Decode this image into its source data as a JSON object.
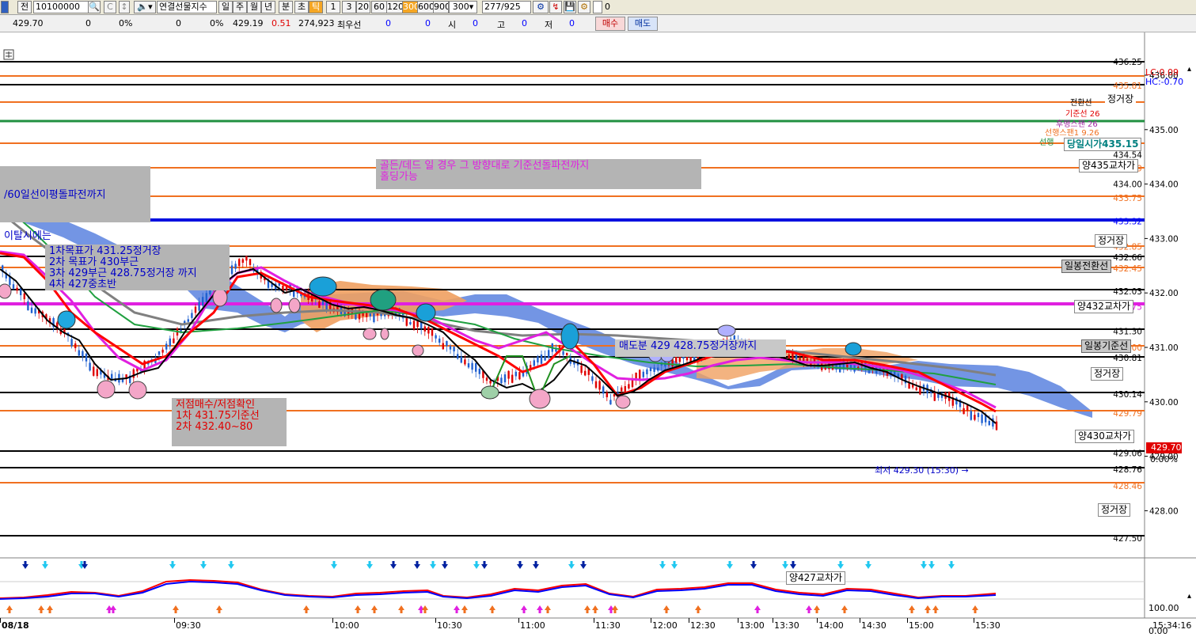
{
  "toolbar": {
    "jeon": "전",
    "code": "10100000",
    "product": "연결선물지수",
    "period_buttons": [
      "일",
      "주",
      "월",
      "년",
      "분",
      "초",
      "틱"
    ],
    "active_period": "틱",
    "intervals": [
      "1",
      "3",
      "20",
      "60",
      "120",
      "300",
      "600",
      "900"
    ],
    "active_interval": "300",
    "interval_select": "300",
    "page_counter": "277/925",
    "check_value": "0"
  },
  "quote": {
    "price": "429.70",
    "v1": "0",
    "pct1": "0%",
    "v2": "0",
    "pct2": "0%",
    "last": "429.19",
    "change": "0.51",
    "volume": "274,923",
    "best_label": "최우선",
    "best_bid": "0",
    "best_ask": "0",
    "open_label": "시",
    "open_val": "0",
    "high_label": "고",
    "high_val": "0",
    "low_label": "저",
    "low_val": "0",
    "buy_label": "매수",
    "sell_label": "매도"
  },
  "chart": {
    "lc": "LC:0.09",
    "hc": "HC:-0.70",
    "last_price_tag": "429.70",
    "last_pct": "0.00%",
    "low_note": "최저 429.30 (15:30)",
    "top_right_labels": [
      "전환선",
      "기준선 26",
      "후행스팬 26",
      "선행스팬1 9.26",
      "선행"
    ],
    "line_values": {
      "v436_25": "436.25",
      "v435_81": "435.81",
      "v434_54": "434.54",
      "v434_29": "434.29",
      "v434_00": "434.00",
      "v433_75": "433.75",
      "v433_32": "433.32",
      "v432_85": "432.85",
      "v432_66": "432.66",
      "v432_45": "432.45",
      "v432_03": "432.03",
      "v431_75": "431.75",
      "v431_30": "431.30",
      "v431_00": "431.00",
      "v430_81": "430.81",
      "v430_14": "430.14",
      "v429_79": "429.79",
      "v429_06": "429.06",
      "v428_76": "428.76",
      "v428_46": "428.46",
      "v427_50": "427.50"
    },
    "y_axis": [
      "436.00",
      "435.00",
      "434.00",
      "433.00",
      "432.00",
      "431.00",
      "430.00",
      "429.00",
      "428.00"
    ],
    "osc_axis": [
      "100.00",
      "0.00"
    ],
    "x_axis": [
      "08/18",
      "09:30",
      "10:00",
      "10:30",
      "11:00",
      "11:30",
      "12:00",
      "12:30",
      "13:00",
      "13:30",
      "14:00",
      "14:30",
      "15:00",
      "15:30"
    ],
    "time_right": "15:34:16",
    "right_tags": {
      "t_jung1": "정거장",
      "t_dangil": "당일시가435.15",
      "t_y435": "양435교차가",
      "t_jung2": "정거장",
      "t_ilbong_j": "일봉전환선",
      "t_y432": "양432교차가",
      "t_ilbong_g": "일봉기준선",
      "t_jung3": "정거장",
      "t_y430": "양430교차가",
      "t_jung4": "정거장",
      "t_y427": "양427교차가"
    },
    "notes": {
      "left_box_line1": "/60일선이평돌파전까지",
      "left_box_line2": "이탈시에는",
      "target_box": "1차목표가 431.25정거장\n2차 목표가 430부근\n3차 429부근 428.75정거장 까지\n4차 427중초반",
      "buy_box": "저점매수/저점확인\n1차 431.75기준선\n2차 432.40~80",
      "magenta_box": "골든/데드 일 경우 그 방향대로 기준선돌파전까지\n홀딩가능",
      "sell_label": "매도분 429 428.75정거장까지"
    }
  }
}
